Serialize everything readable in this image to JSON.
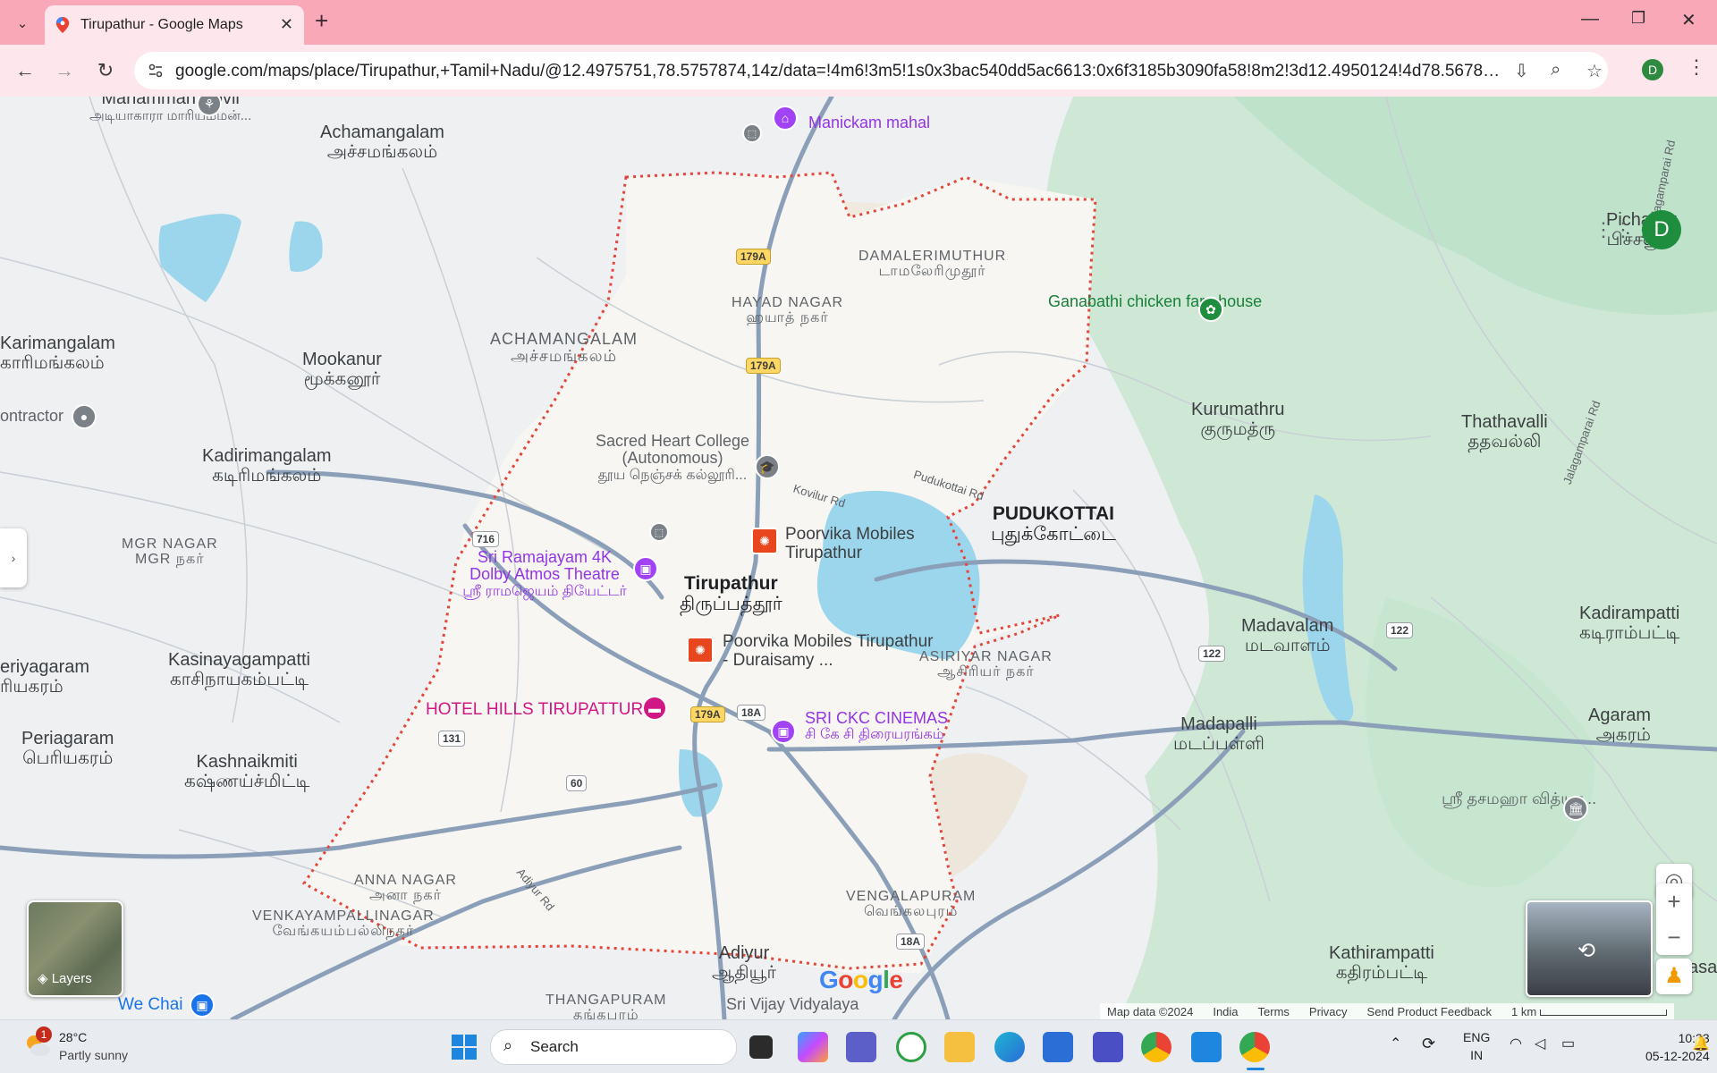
{
  "browser": {
    "tab_title": "Tirupathur - Google Maps",
    "new_tab": "+",
    "url": "google.com/maps/place/Tirupathur,+Tamil+Nadu/@12.4975751,78.5757874,14z/data=!4m6!3m5!1s0x3bac540dd5ac6613:0x6f3185b3090fa58!8m2!3d12.4950124!4d78.5678407!16zL20vMGN...",
    "profile_initial": "D"
  },
  "map": {
    "avatar_initial": "D",
    "towns": {
      "achamangalam_nw": {
        "en": "Achamangalam",
        "ta": "அச்சமங்கலம்"
      },
      "pichanur": {
        "en": "Pichanur",
        "ta": "பிச்சனூர்"
      },
      "karimangalam": {
        "en": "Karimangalam",
        "ta": "காரிமங்கலம்"
      },
      "mookanur": {
        "en": "Mookanur",
        "ta": "மூக்கனூர்"
      },
      "kurumathru": {
        "en": "Kurumathru",
        "ta": "குருமத்ரு"
      },
      "thathavalli": {
        "en": "Thathavalli",
        "ta": "ததவல்லி"
      },
      "kadirimangalam": {
        "en": "Kadirimangalam",
        "ta": "கடிரிமங்கலம்"
      },
      "pudukottai": {
        "en": "PUDUKOTTAI",
        "ta": "புதுக்கோட்டை"
      },
      "tirupathur": {
        "en": "Tirupathur",
        "ta": "திருப்பத்தூர்"
      },
      "madavalam": {
        "en": "Madavalam",
        "ta": "மடவாளம்"
      },
      "kadirampatti": {
        "en": "Kadirampatti",
        "ta": "கடிராம்பட்டி"
      },
      "periyagaram": {
        "en": "eriyagaram",
        "ta": "ரியகரம்"
      },
      "kasinayagampatti": {
        "en": "Kasinayagampatti",
        "ta": "காசிநாயகம்பட்டி"
      },
      "periagaram": {
        "en": "Periagaram",
        "ta": "பெரியகரம்"
      },
      "kashnaikmiti": {
        "en": "Kashnaikmiti",
        "ta": "கஷ்ணய்ச்மிட்டி"
      },
      "madapalli": {
        "en": "Madapalli",
        "ta": "மடப்பள்ளி"
      },
      "agaram": {
        "en": "Agaram",
        "ta": "அகரம்"
      },
      "adiyur": {
        "en": "Adiyur",
        "ta": "ஆதியூர்"
      },
      "kathirampatti": {
        "en": "Kathirampatti",
        "ta": "கதிரம்பட்டி"
      },
      "mariamman": {
        "en": "Mariamman Kovil",
        "ta": "அடியாகாரா மாரியம்மன்..."
      }
    },
    "neighborhoods": {
      "damalerimuthur": {
        "en": "DAMALERIMUTHUR",
        "ta": "டாமலேரிமுதூர்"
      },
      "hayad_nagar": {
        "en": "HAYAD NAGAR",
        "ta": "ஹயாத் நகர்"
      },
      "achamangalam": {
        "en": "ACHAMANGALAM",
        "ta": "அச்சமங்கலம்"
      },
      "mgr_nagar": {
        "en": "MGR NAGAR",
        "ta": "MGR நகர்"
      },
      "asiriyar_nagar": {
        "en": "ASIRIYAR NAGAR",
        "ta": "ஆசிரியர் நகர்"
      },
      "anna_nagar": {
        "en": "ANNA NAGAR",
        "ta": "அனா நகர்"
      },
      "venkayampallinagar": {
        "en": "VENKAYAMPALLINAGAR",
        "ta": "வேங்கயம்பல்லிநகர்"
      },
      "vengalapuram": {
        "en": "VENGALAPURAM",
        "ta": "வெங்கலபுரம்"
      },
      "thangapuram": {
        "en": "THANGAPURAM",
        "ta": "தங்கபுரம்"
      }
    },
    "pois": {
      "manickam_mahal": "Manickam mahal",
      "ganabathi": "Ganabathi chicken farmhouse",
      "contractor": "ontractor",
      "sacred_heart": {
        "en": "Sacred Heart College (Autonomous)",
        "ta": "தூய நெஞ்சக் கல்லூரி..."
      },
      "poorvika_1": "Poorvika Mobiles Tirupathur",
      "sri_ramajayam": {
        "en": "Sri Ramajayam 4K Dolby Atmos Theatre",
        "ta": "ஸ்ரீ ராமஜெயம் தியேட்டர்"
      },
      "poorvika_2": "Poorvika Mobiles Tirupathur - Duraisamy ...",
      "hotel_hills": "HOTEL HILLS TIRUPATTUR",
      "sri_ckc": {
        "en": "SRI CKC CINEMAS",
        "ta": "சி கே சி திரையரங்கம்"
      },
      "sri_thasmaha": "ஸ்ரீ தசமஹா வித்யா...",
      "we_chai": "We Chai",
      "sri_vijay": "Sri Vijay Vidyalaya",
      "pasa": "asa"
    },
    "roads": {
      "kovilur": "Kovilur Rd",
      "pudukottai": "Pudukottai Rd",
      "adiyur": "Adiyur Rd",
      "jalagamparai": "Jalagamparai Rd"
    },
    "shields": [
      "179A",
      "179A",
      "716",
      "179A",
      "18A",
      "131",
      "60",
      "122",
      "122",
      "18A"
    ],
    "layers_label": "Layers",
    "google_logo": "Google",
    "attribution": [
      "Map data ©2024",
      "India",
      "Terms",
      "Privacy",
      "Send Product Feedback",
      "1 km"
    ]
  },
  "taskbar": {
    "weather_badge": "1",
    "temperature": "28°C",
    "weather": "Partly sunny",
    "search": "Search",
    "lang_top": "ENG",
    "lang_bottom": "IN",
    "time": "10:33",
    "date": "05-12-2024"
  },
  "colors": {
    "tabstrip": "#f9a8b8",
    "toolbar": "#fde7ec",
    "water": "#9cd6ec",
    "boundary": "#e3473b",
    "road_major": "#8ba0b8"
  }
}
